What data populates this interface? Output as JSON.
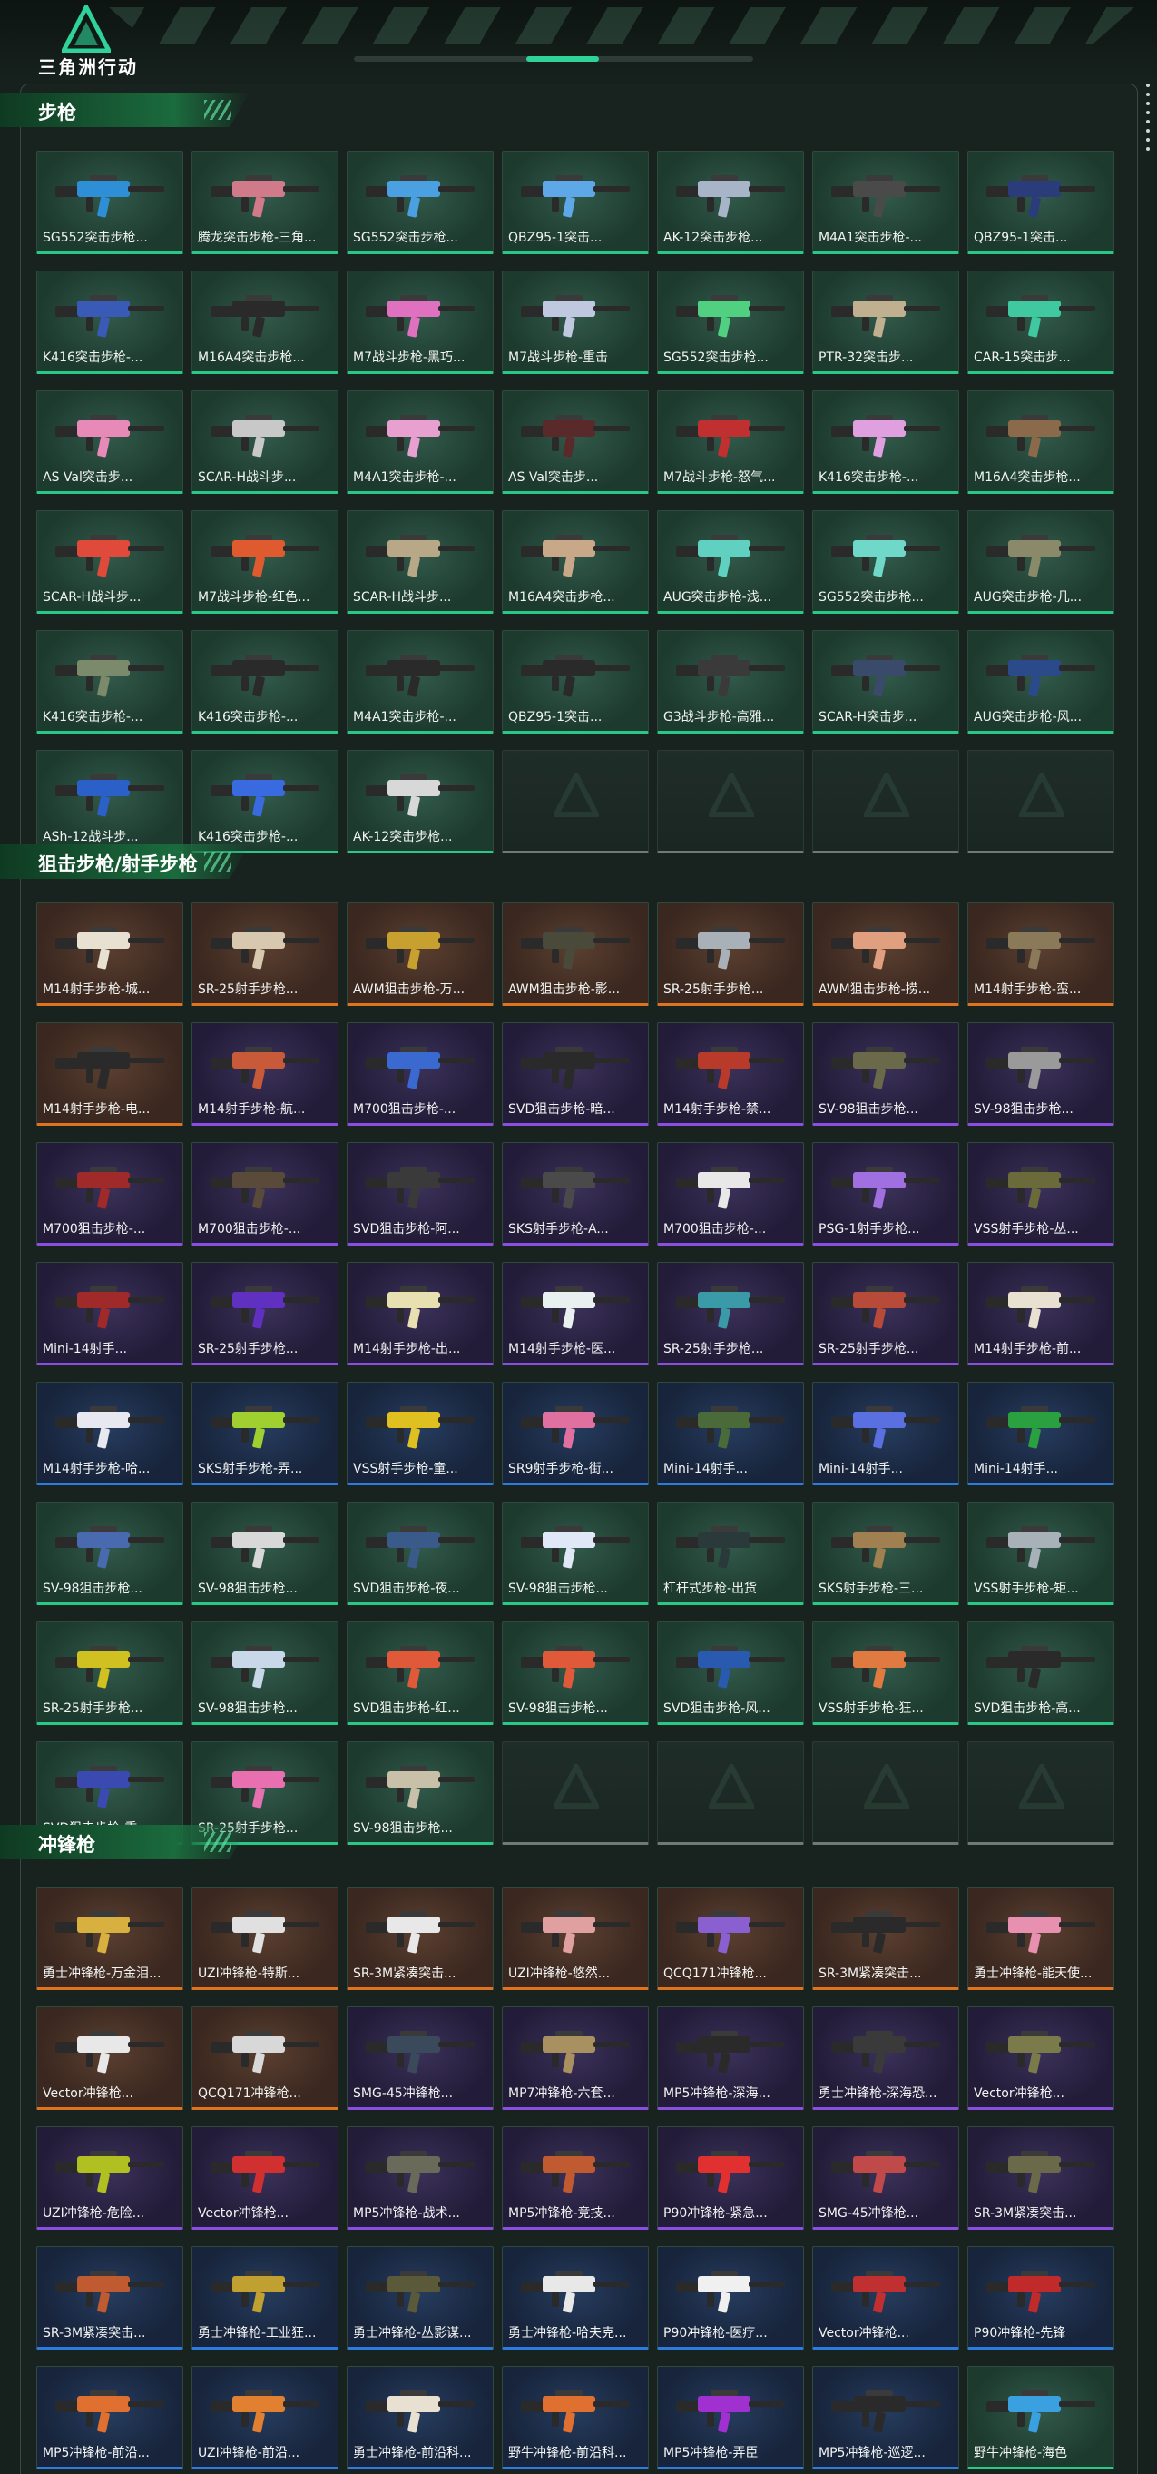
{
  "header": {
    "title": "三角洲行动"
  },
  "sections": [
    {
      "title": "步枪",
      "items": [
        {
          "label": "SG552突击步枪...",
          "tier": "green",
          "color": "#2e8fd6"
        },
        {
          "label": "腾龙突击步枪-三角...",
          "tier": "green",
          "color": "#d07a8a"
        },
        {
          "label": "SG552突击步枪...",
          "tier": "green",
          "color": "#4aa0e0"
        },
        {
          "label": "QBZ95-1突击...",
          "tier": "green",
          "color": "#5fa8e8"
        },
        {
          "label": "AK-12突击步枪...",
          "tier": "green",
          "color": "#a8b4c8"
        },
        {
          "label": "M4A1突击步枪-...",
          "tier": "green",
          "color": "#4a4a4a"
        },
        {
          "label": "QBZ95-1突击...",
          "tier": "green",
          "color": "#2a3c7a"
        },
        {
          "label": "K416突击步枪-...",
          "tier": "green",
          "color": "#3a5ab8"
        },
        {
          "label": "M16A4突击步枪...",
          "tier": "green",
          "color": "#2a2a2a"
        },
        {
          "label": "M7战斗步枪-黑巧...",
          "tier": "green",
          "color": "#e070c0"
        },
        {
          "label": "M7战斗步枪-重击",
          "tier": "green",
          "color": "#c0c8e0"
        },
        {
          "label": "SG552突击步枪...",
          "tier": "green",
          "color": "#50d080"
        },
        {
          "label": "PTR-32突击步...",
          "tier": "green",
          "color": "#c0b090"
        },
        {
          "label": "CAR-15突击步...",
          "tier": "green",
          "color": "#40c8a0"
        },
        {
          "label": "AS Val突击步...",
          "tier": "green",
          "color": "#e88ab8"
        },
        {
          "label": "SCAR-H战斗步...",
          "tier": "green",
          "color": "#c8c8c8"
        },
        {
          "label": "M4A1突击步枪-...",
          "tier": "green",
          "color": "#e8a0d0"
        },
        {
          "label": "AS Val突击步...",
          "tier": "green",
          "color": "#5a2a2a"
        },
        {
          "label": "M7战斗步枪-怒气...",
          "tier": "green",
          "color": "#c03030"
        },
        {
          "label": "K416突击步枪-...",
          "tier": "green",
          "color": "#e0a0e0"
        },
        {
          "label": "M16A4突击步枪...",
          "tier": "green",
          "color": "#8a6a4a"
        },
        {
          "label": "SCAR-H战斗步...",
          "tier": "green",
          "color": "#e04a3a"
        },
        {
          "label": "M7战斗步枪-红色...",
          "tier": "green",
          "color": "#e05a30"
        },
        {
          "label": "SCAR-H战斗步...",
          "tier": "green",
          "color": "#b8a888"
        },
        {
          "label": "M16A4突击步枪...",
          "tier": "green",
          "color": "#c8a888"
        },
        {
          "label": "AUG突击步枪-浅...",
          "tier": "green",
          "color": "#60d0c0"
        },
        {
          "label": "SG552突击步枪...",
          "tier": "green",
          "color": "#70d8c8"
        },
        {
          "label": "AUG突击步枪-几...",
          "tier": "green",
          "color": "#8a8a6a"
        },
        {
          "label": "K416突击步枪-...",
          "tier": "green",
          "color": "#7a8a6a"
        },
        {
          "label": "K416突击步枪-...",
          "tier": "green",
          "color": "#2a2a2a"
        },
        {
          "label": "M4A1突击步枪-...",
          "tier": "green",
          "color": "#2a2a2a"
        },
        {
          "label": "QBZ95-1突击...",
          "tier": "green",
          "color": "#2a2a2a"
        },
        {
          "label": "G3战斗步枪-高雅...",
          "tier": "green",
          "color": "#3a3a3a"
        },
        {
          "label": "SCAR-H突击步...",
          "tier": "green",
          "color": "#3a4a6a"
        },
        {
          "label": "AUG突击步枪-风...",
          "tier": "green",
          "color": "#2a4a8a"
        },
        {
          "label": "ASh-12战斗步...",
          "tier": "green",
          "color": "#2a60c8"
        },
        {
          "label": "K416突击步枪-...",
          "tier": "green",
          "color": "#3a6ae0"
        },
        {
          "label": "AK-12突击步枪...",
          "tier": "green",
          "color": "#d8d8d8"
        },
        {
          "label": "",
          "tier": "empty",
          "color": ""
        },
        {
          "label": "",
          "tier": "empty",
          "color": ""
        },
        {
          "label": "",
          "tier": "empty",
          "color": ""
        },
        {
          "label": "",
          "tier": "empty",
          "color": ""
        }
      ]
    },
    {
      "title": "狙击步枪/射手步枪",
      "items": [
        {
          "label": "M14射手步枪-城...",
          "tier": "orange",
          "color": "#e8e0d0"
        },
        {
          "label": "SR-25射手步枪...",
          "tier": "orange",
          "color": "#d8c8b0"
        },
        {
          "label": "AWM狙击步枪-万...",
          "tier": "orange",
          "color": "#c8a030"
        },
        {
          "label": "AWM狙击步枪-影...",
          "tier": "orange",
          "color": "#4a4a3a"
        },
        {
          "label": "SR-25射手步枪...",
          "tier": "orange",
          "color": "#a8b0b8"
        },
        {
          "label": "AWM狙击步枪-捞...",
          "tier": "orange",
          "color": "#e0a080"
        },
        {
          "label": "M14射手步枪-蛮...",
          "tier": "orange",
          "color": "#8a7a5a"
        },
        {
          "label": "M14射手步枪-电...",
          "tier": "orange",
          "color": "#2a2a2a"
        },
        {
          "label": "M14射手步枪-航...",
          "tier": "purple",
          "color": "#c85a3a"
        },
        {
          "label": "M700狙击步枪-...",
          "tier": "purple",
          "color": "#3a6ad0"
        },
        {
          "label": "SVD狙击步枪-暗...",
          "tier": "purple",
          "color": "#2a2a2a"
        },
        {
          "label": "M14射手步枪-禁...",
          "tier": "purple",
          "color": "#b83a2a"
        },
        {
          "label": "SV-98狙击步枪...",
          "tier": "purple",
          "color": "#6a6a4a"
        },
        {
          "label": "SV-98狙击步枪...",
          "tier": "purple",
          "color": "#9a9a9a"
        },
        {
          "label": "M700狙击步枪-...",
          "tier": "purple",
          "color": "#a02a2a"
        },
        {
          "label": "M700狙击步枪-...",
          "tier": "purple",
          "color": "#5a4a3a"
        },
        {
          "label": "SVD狙击步枪-阿...",
          "tier": "purple",
          "color": "#3a3a3a"
        },
        {
          "label": "SKS射手步枪-A...",
          "tier": "purple",
          "color": "#4a4a4a"
        },
        {
          "label": "M700狙击步枪-...",
          "tier": "purple",
          "color": "#e8e8e8"
        },
        {
          "label": "PSG-1射手步枪...",
          "tier": "purple",
          "color": "#a070e0"
        },
        {
          "label": "VSS射手步枪-丛...",
          "tier": "purple",
          "color": "#6a6a3a"
        },
        {
          "label": "Mini-14射手...",
          "tier": "purple",
          "color": "#a02a2a"
        },
        {
          "label": "SR-25射手步枪...",
          "tier": "purple",
          "color": "#6030c0"
        },
        {
          "label": "M14射手步枪-出...",
          "tier": "purple",
          "color": "#e8e0b0"
        },
        {
          "label": "M14射手步枪-医...",
          "tier": "purple",
          "color": "#e8f0f0"
        },
        {
          "label": "SR-25射手步枪...",
          "tier": "purple",
          "color": "#3a9aa8"
        },
        {
          "label": "SR-25射手步枪...",
          "tier": "purple",
          "color": "#b84a3a"
        },
        {
          "label": "M14射手步枪-前...",
          "tier": "purple",
          "color": "#e8e0d0"
        },
        {
          "label": "M14射手步枪-哈...",
          "tier": "blue",
          "color": "#e8e8f0"
        },
        {
          "label": "SKS射手步枪-弄...",
          "tier": "blue",
          "color": "#a0d030"
        },
        {
          "label": "VSS射手步枪-童...",
          "tier": "blue",
          "color": "#e0c020"
        },
        {
          "label": "SR9射手步枪-街...",
          "tier": "blue",
          "color": "#e070a0"
        },
        {
          "label": "Mini-14射手...",
          "tier": "blue",
          "color": "#4a6a3a"
        },
        {
          "label": "Mini-14射手...",
          "tier": "blue",
          "color": "#5a70e0"
        },
        {
          "label": "Mini-14射手...",
          "tier": "blue",
          "color": "#2aa040"
        },
        {
          "label": "SV-98狙击步枪...",
          "tier": "green",
          "color": "#4a6ab0"
        },
        {
          "label": "SV-98狙击步枪...",
          "tier": "green",
          "color": "#d8d8d8"
        },
        {
          "label": "SVD狙击步枪-夜...",
          "tier": "green",
          "color": "#3a5a8a"
        },
        {
          "label": "SV-98狙击步枪...",
          "tier": "green",
          "color": "#e0e8f8"
        },
        {
          "label": "杠杆式步枪-出货",
          "tier": "green",
          "color": "#2a3a3a"
        },
        {
          "label": "SKS射手步枪-三...",
          "tier": "green",
          "color": "#a08050"
        },
        {
          "label": "VSS射手步枪-矩...",
          "tier": "green",
          "color": "#a8b0b8"
        },
        {
          "label": "SR-25射手步枪...",
          "tier": "green",
          "color": "#d0c020"
        },
        {
          "label": "SV-98狙击步枪...",
          "tier": "green",
          "color": "#c8d8e8"
        },
        {
          "label": "SVD狙击步枪-红...",
          "tier": "green",
          "color": "#e05a3a"
        },
        {
          "label": "SV-98狙击步枪...",
          "tier": "green",
          "color": "#e05a3a"
        },
        {
          "label": "SVD狙击步枪-风...",
          "tier": "green",
          "color": "#2a5ab0"
        },
        {
          "label": "VSS射手步枪-狂...",
          "tier": "green",
          "color": "#e07a40"
        },
        {
          "label": "SVD狙击步枪-高...",
          "tier": "green",
          "color": "#2a2a2a"
        },
        {
          "label": "SVD狙击步枪-重...",
          "tier": "green",
          "color": "#3a4ab0"
        },
        {
          "label": "SR-25射手步枪...",
          "tier": "green",
          "color": "#e870b0"
        },
        {
          "label": "SV-98狙击步枪...",
          "tier": "green",
          "color": "#c8c0a8"
        },
        {
          "label": "",
          "tier": "empty",
          "color": ""
        },
        {
          "label": "",
          "tier": "empty",
          "color": ""
        },
        {
          "label": "",
          "tier": "empty",
          "color": ""
        },
        {
          "label": "",
          "tier": "empty",
          "color": ""
        }
      ]
    },
    {
      "title": "冲锋枪",
      "items": [
        {
          "label": "勇士冲锋枪-万金泪...",
          "tier": "orange",
          "color": "#d8b040"
        },
        {
          "label": "UZI冲锋枪-特斯...",
          "tier": "orange",
          "color": "#e0e0e0"
        },
        {
          "label": "SR-3M紧凑突击...",
          "tier": "orange",
          "color": "#e8e8e8"
        },
        {
          "label": "UZI冲锋枪-悠然...",
          "tier": "orange",
          "color": "#e0a0a0"
        },
        {
          "label": "QCQ171冲锋枪...",
          "tier": "orange",
          "color": "#8a60d0"
        },
        {
          "label": "SR-3M紧凑突击...",
          "tier": "orange",
          "color": "#2a2a2a"
        },
        {
          "label": "勇士冲锋枪-能天使...",
          "tier": "orange",
          "color": "#e890b0"
        },
        {
          "label": "Vector冲锋枪...",
          "tier": "orange",
          "color": "#e8e8e8"
        },
        {
          "label": "QCQ171冲锋枪...",
          "tier": "orange",
          "color": "#d8d8d8"
        },
        {
          "label": "SMG-45冲锋枪...",
          "tier": "purple",
          "color": "#3a4a5a"
        },
        {
          "label": "MP7冲锋枪-六套...",
          "tier": "purple",
          "color": "#a89060"
        },
        {
          "label": "MP5冲锋枪-深海...",
          "tier": "purple",
          "color": "#2a2a2a"
        },
        {
          "label": "勇士冲锋枪-深海恐...",
          "tier": "purple",
          "color": "#3a3a3a"
        },
        {
          "label": "Vector冲锋枪...",
          "tier": "purple",
          "color": "#7a7a4a"
        },
        {
          "label": "UZI冲锋枪-危险...",
          "tier": "purple",
          "color": "#b0c020"
        },
        {
          "label": "Vector冲锋枪...",
          "tier": "purple",
          "color": "#d03030"
        },
        {
          "label": "MP5冲锋枪-战术...",
          "tier": "purple",
          "color": "#6a6a5a"
        },
        {
          "label": "MP5冲锋枪-竞技...",
          "tier": "purple",
          "color": "#c05a30"
        },
        {
          "label": "P90冲锋枪-紧急...",
          "tier": "purple",
          "color": "#e03030"
        },
        {
          "label": "SMG-45冲锋枪...",
          "tier": "purple",
          "color": "#c04a4a"
        },
        {
          "label": "SR-3M紧凑突击...",
          "tier": "purple",
          "color": "#6a6a4a"
        },
        {
          "label": "SR-3M紧凑突击...",
          "tier": "blue",
          "color": "#c05a30"
        },
        {
          "label": "勇士冲锋枪-工业狂...",
          "tier": "blue",
          "color": "#c0a030"
        },
        {
          "label": "勇士冲锋枪-丛影谋...",
          "tier": "blue",
          "color": "#5a5a3a"
        },
        {
          "label": "勇士冲锋枪-哈夫克...",
          "tier": "blue",
          "color": "#e8e8e8"
        },
        {
          "label": "P90冲锋枪-医疗...",
          "tier": "blue",
          "color": "#f0f0f0"
        },
        {
          "label": "Vector冲锋枪...",
          "tier": "blue",
          "color": "#c03030"
        },
        {
          "label": "P90冲锋枪-先锋",
          "tier": "blue",
          "color": "#c02a2a"
        },
        {
          "label": "MP5冲锋枪-前沿...",
          "tier": "blue",
          "color": "#e07030"
        },
        {
          "label": "UZI冲锋枪-前沿...",
          "tier": "blue",
          "color": "#e08030"
        },
        {
          "label": "勇士冲锋枪-前沿科...",
          "tier": "blue",
          "color": "#e8e0d0"
        },
        {
          "label": "野牛冲锋枪-前沿科...",
          "tier": "blue",
          "color": "#e07030"
        },
        {
          "label": "MP5冲锋枪-弄臣",
          "tier": "blue",
          "color": "#a030d0"
        },
        {
          "label": "MP5冲锋枪-巡逻...",
          "tier": "blue",
          "color": "#2a2a2a"
        },
        {
          "label": "野牛冲锋枪-海色",
          "tier": "green",
          "color": "#3aa0e0"
        }
      ]
    }
  ]
}
